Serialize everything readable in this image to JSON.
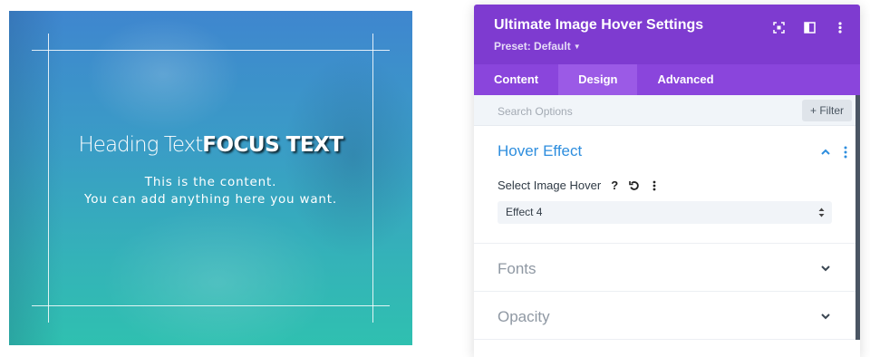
{
  "preview": {
    "heading_light": "Heading Text",
    "heading_focus": "FOCUS TEXT",
    "content_line1": "This is the content.",
    "content_line2": "You can add anything here you want."
  },
  "panel": {
    "title": "Ultimate Image Hover Settings",
    "preset": "Preset: Default",
    "header_icons": [
      "expand-icon",
      "split-view-icon",
      "more-options-icon"
    ],
    "tabs": [
      {
        "label": "Content",
        "active": false
      },
      {
        "label": "Design",
        "active": true
      },
      {
        "label": "Advanced",
        "active": false
      }
    ],
    "search_placeholder": "Search Options",
    "filter_label": "+ Filter",
    "sections": {
      "hover_effect": {
        "title": "Hover Effect",
        "expanded": true,
        "field_label": "Select Image Hover",
        "field_icons": [
          "help-icon",
          "reset-icon",
          "more-options-icon"
        ],
        "selected_value": "Effect 4"
      },
      "fonts": {
        "title": "Fonts",
        "expanded": false
      },
      "opacity": {
        "title": "Opacity",
        "expanded": false
      }
    },
    "colors": {
      "header": "#7e3bd0",
      "tabs": "#8a45dc",
      "active_tab": "#9b5ae6",
      "section_active": "#2e8ede"
    }
  }
}
